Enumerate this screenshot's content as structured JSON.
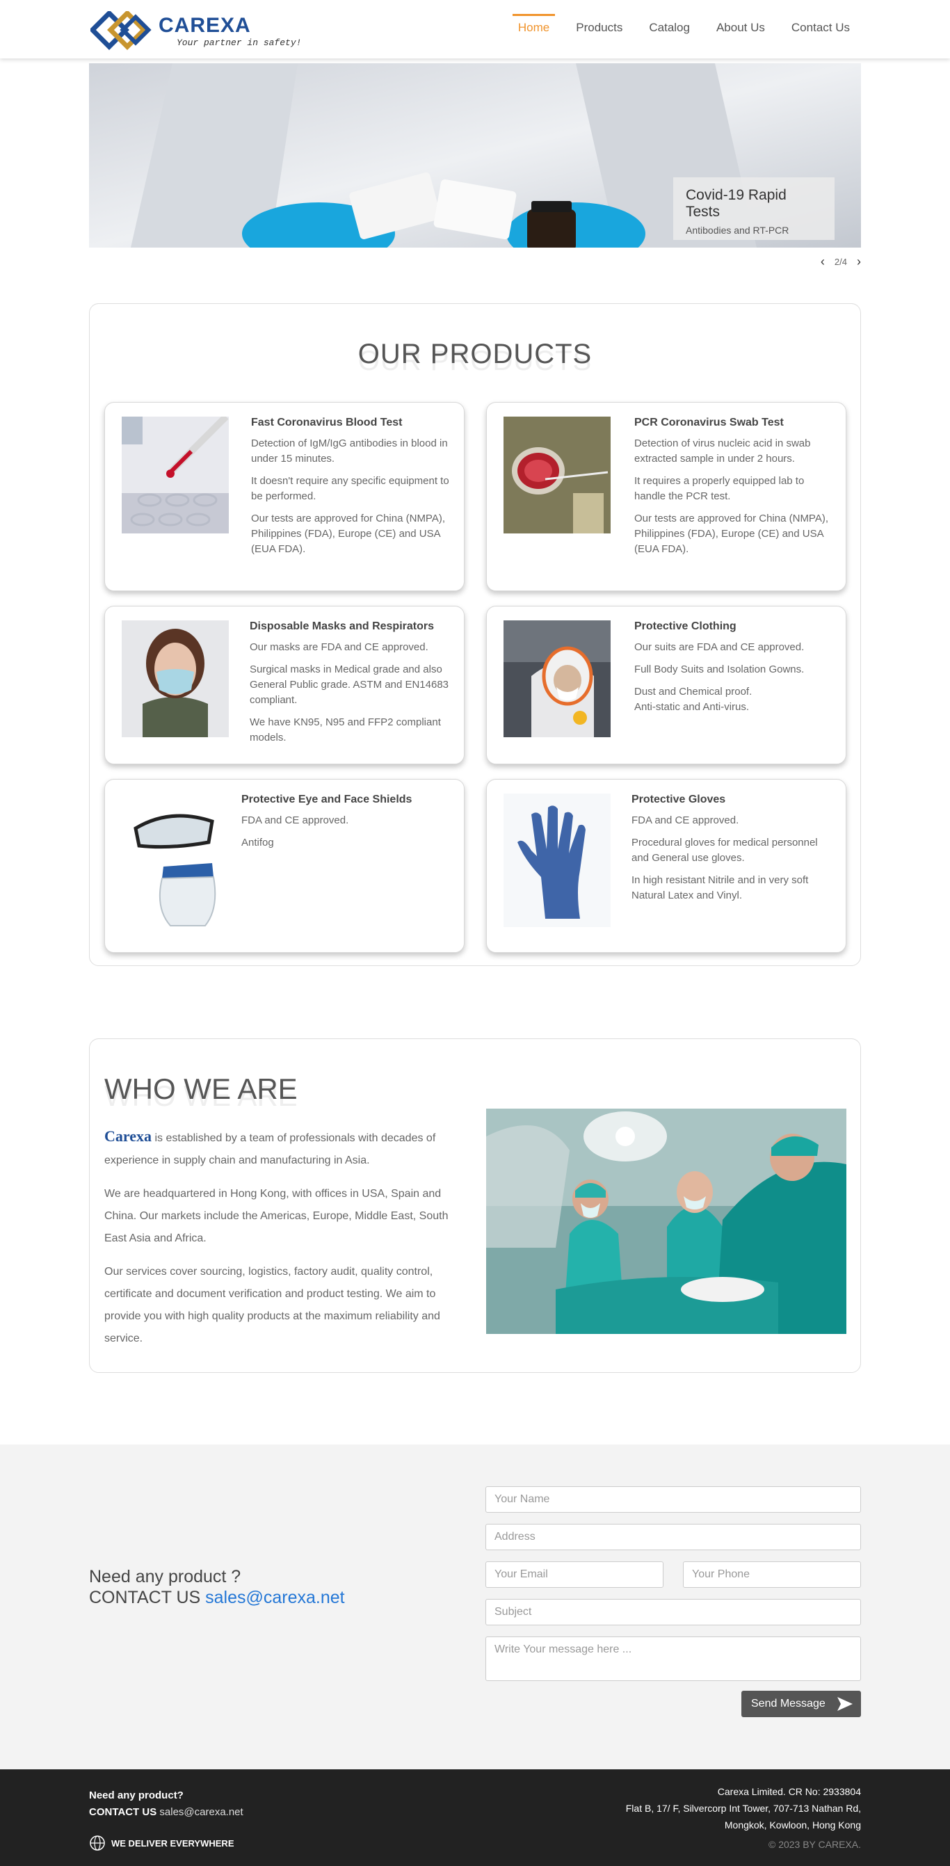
{
  "header": {
    "brand": "CAREXA",
    "tagline": "Your partner in safety!",
    "nav": [
      "Home",
      "Products",
      "Catalog",
      "About Us",
      "Contact Us"
    ],
    "active_nav": "Home",
    "accent_color": "#f0932b",
    "brand_color": "#1f4e96"
  },
  "hero": {
    "caption_title": "Covid-19 Rapid Tests",
    "caption_sub": "Antibodies and RT-PCR",
    "prev_icon": "chevron-left-icon",
    "next_icon": "chevron-right-icon",
    "counter": "2/4"
  },
  "products": {
    "title": "OUR PRODUCTS",
    "items": [
      {
        "title": "Fast Coronavirus Blood Test",
        "paras": [
          "Detection of IgM/IgG antibodies in blood in under 15 minutes.",
          "It doesn't require any specific equipment to be performed.",
          "Our tests are approved for China (NMPA), Philippines (FDA), Europe (CE) and USA (EUA FDA)."
        ]
      },
      {
        "title": "PCR Coronavirus Swab Test",
        "paras": [
          "Detection of virus nucleic acid in swab extracted sample in under 2 hours.",
          "It requires a properly equipped lab to handle the PCR test.",
          "Our tests are approved for China (NMPA), Philippines (FDA), Europe (CE) and USA (EUA FDA)."
        ]
      },
      {
        "title": "Disposable Masks and Respirators",
        "paras": [
          "Our masks are FDA and CE approved.",
          "Surgical masks in Medical grade and also General Public grade. ASTM and EN14683 compliant.",
          "We have KN95, N95 and FFP2 compliant models."
        ]
      },
      {
        "title": "Protective Clothing",
        "paras": [
          "Our suits are FDA and CE approved.",
          "Full Body Suits and Isolation Gowns.",
          "Dust and Chemical proof.",
          "Anti-static and Anti-virus."
        ]
      },
      {
        "title": "Protective Eye and Face Shields",
        "paras": [
          "FDA and CE approved.",
          "Antifog"
        ]
      },
      {
        "title": "Protective Gloves",
        "paras": [
          "FDA and CE approved.",
          "Procedural gloves for medical personnel and General use gloves.",
          "In high resistant Nitrile and in very soft Natural Latex and Vinyl."
        ]
      }
    ]
  },
  "who": {
    "title": "WHO WE ARE",
    "brand_inline": "Carexa",
    "p1_rest": " is established by a team of professionals with decades of experience in supply chain and manufacturing in Asia.",
    "p2": "We are headquartered in Hong Kong, with offices in USA, Spain and China. Our markets include the Americas, Europe, Middle East, South East Asia and Africa.",
    "p3": "Our services cover sourcing, logistics, factory audit, quality control, certificate and document verification and product testing. We aim to provide you with high quality products at the maximum reliability and service."
  },
  "contact": {
    "line1": "Need any product ?",
    "line2_prefix": "CONTACT US ",
    "email": "sales@carexa.net",
    "placeholders": {
      "name": "Your Name",
      "address": "Address",
      "email": "Your Email",
      "phone": "Your Phone",
      "subject": "Subject",
      "message": "Write Your message here ..."
    },
    "send_label": "Send Message"
  },
  "footer": {
    "need": "Need any product?",
    "contact_prefix": "CONTACT US ",
    "email": "sales@carexa.net",
    "deliver": "WE DELIVER EVERYWHERE",
    "company": "Carexa Limited. CR No: 2933804",
    "addr1": "Flat B, 17/ F, Silvercorp Int Tower, 707-713 Nathan Rd,",
    "addr2": "Mongkok, Kowloon, Hong Kong",
    "copyright": "© 2023 BY CAREXA."
  }
}
